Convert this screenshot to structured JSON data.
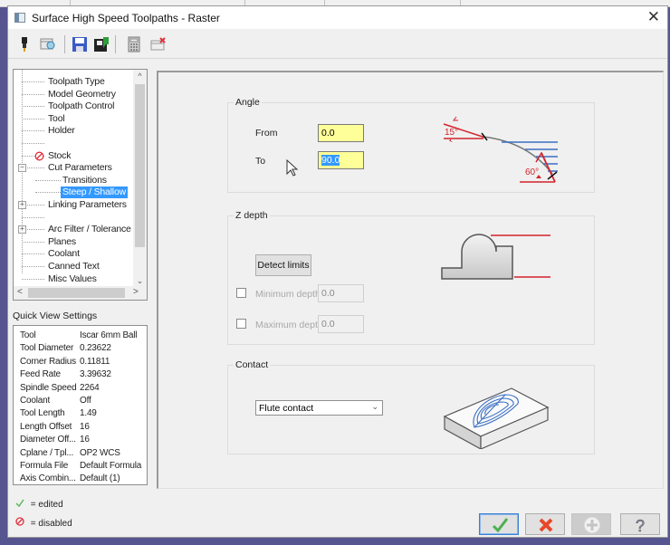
{
  "dialog": {
    "title": "Surface High Speed Toolpaths - Raster",
    "close_glyph": "✕"
  },
  "toolbar": {
    "icons": [
      "tool-icon",
      "view-sheet-icon",
      "save-icon",
      "save-to-library-icon",
      "calculator-icon",
      "close-window-icon"
    ]
  },
  "tree": {
    "items": [
      {
        "label": "Toolpath Type",
        "level": 1
      },
      {
        "label": "Model Geometry",
        "level": 1
      },
      {
        "label": "Toolpath Control",
        "level": 1
      },
      {
        "label": "Tool",
        "level": 1
      },
      {
        "label": "Holder",
        "level": 1
      },
      {
        "label": "",
        "level": 1
      },
      {
        "label": "Stock",
        "level": 1,
        "status": "disabled"
      },
      {
        "label": "Cut Parameters",
        "level": 1,
        "expanded": true
      },
      {
        "label": "Transitions",
        "level": 2
      },
      {
        "label": "Steep / Shallow",
        "level": 2,
        "selected": true
      },
      {
        "label": "Linking Parameters",
        "level": 1,
        "collapsed": true
      },
      {
        "label": "",
        "level": 1
      },
      {
        "label": "Arc Filter / Tolerance",
        "level": 1,
        "collapsed": true
      },
      {
        "label": "Planes",
        "level": 1
      },
      {
        "label": "Coolant",
        "level": 1
      },
      {
        "label": "Canned Text",
        "level": 1
      },
      {
        "label": "Misc Values",
        "level": 1
      }
    ]
  },
  "quick_view": {
    "label": "Quick View Settings",
    "rows": [
      {
        "key": "Tool",
        "value": "Iscar 6mm Ball"
      },
      {
        "key": "Tool Diameter",
        "value": "0.23622"
      },
      {
        "key": "Corner Radius",
        "value": "0.11811"
      },
      {
        "key": "Feed Rate",
        "value": "3.39632"
      },
      {
        "key": "Spindle Speed",
        "value": "2264"
      },
      {
        "key": "Coolant",
        "value": "Off"
      },
      {
        "key": "Tool Length",
        "value": "1.49"
      },
      {
        "key": "Length Offset",
        "value": "16"
      },
      {
        "key": "Diameter Off...",
        "value": "16"
      },
      {
        "key": "Cplane / Tpl...",
        "value": "OP2 WCS"
      },
      {
        "key": "Formula File",
        "value": "Default Formula"
      },
      {
        "key": "Axis Combin...",
        "value": "Default (1)"
      }
    ]
  },
  "legend": {
    "edited": "= edited",
    "disabled": "= disabled"
  },
  "angle": {
    "title": "Angle",
    "from_label": "From",
    "from_value": "0.0",
    "to_label": "To",
    "to_value": "90.0",
    "diagram_labels": {
      "shallow": "15°",
      "steep": "60°"
    }
  },
  "zdepth": {
    "title": "Z depth",
    "detect_button": "Detect limits",
    "min_label": "Minimum depth",
    "min_value": "0.0",
    "min_checked": false,
    "max_label": "Maximum depth",
    "max_value": "0.0",
    "max_checked": false
  },
  "contact": {
    "title": "Contact",
    "selected": "Flute contact"
  },
  "footer": {
    "ok": "ok-check-icon",
    "cancel": "cancel-x-icon",
    "add": "add-plus-icon",
    "help": "help-question-icon"
  },
  "colors": {
    "accent_red": "#d2232a",
    "accent_blue": "#3a6fc4",
    "selection": "#3399ff",
    "input_yellow": "#ffff99"
  }
}
